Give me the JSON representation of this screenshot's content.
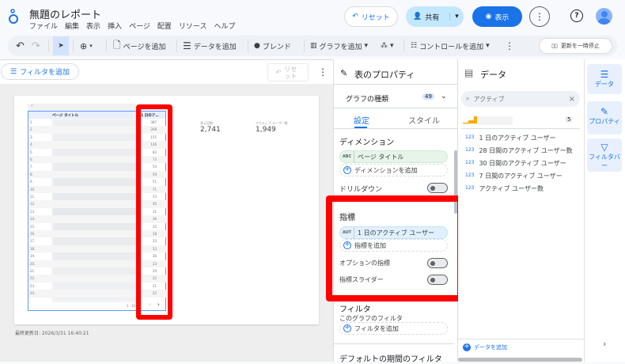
{
  "app": {
    "title": "無題のレポート",
    "menu": [
      "ファイル",
      "編集",
      "表示",
      "挿入",
      "ページ",
      "配置",
      "リソース",
      "ヘルプ"
    ],
    "reset": "リセット",
    "share": "共有",
    "view": "表示"
  },
  "toolbar": {
    "add_page": "ページを追加",
    "add_data": "データを追加",
    "blend": "ブレンド",
    "add_chart": "グラフを追加",
    "add_control": "コントロールを追加",
    "pause": "更新を一時停止"
  },
  "canvas": {
    "add_filter": "フィルタを追加",
    "reset": "リセット",
    "last_updated": "最終更新日: 2026/3/31 16:40:21",
    "table": {
      "col1": "ページ タイトル",
      "col2": "1 日のア…",
      "pagination": "1 - 100",
      "rows": [
        387,
        208,
        155,
        126,
        83,
        73,
        54,
        59,
        51,
        71,
        53,
        45,
        31,
        36,
        25,
        18,
        33,
        33,
        36,
        23,
        29,
        25,
        21,
        22
      ]
    },
    "scorecards": [
      {
        "label": "表示回数",
        "value": "2,741"
      },
      {
        "label": "アクティブ ユーザー数",
        "value": "1,949"
      }
    ]
  },
  "properties": {
    "title": "表のプロパティ",
    "chart_type": "グラフの種類",
    "chart_type_count": "49",
    "tabs": [
      "設定",
      "スタイル"
    ],
    "dimension_title": "ディメンション",
    "dimension_tag": "ABC",
    "dimension": "ページ タイトル",
    "add_dimension": "ディメンションを追加",
    "drilldown": "ドリルダウン",
    "metric_title": "指標",
    "metric_tag": "AUT",
    "metric": "1 日のアクティブ ユーザー",
    "add_metric": "指標を追加",
    "optional_metrics": "オプションの指標",
    "metric_slider": "指標スライダー",
    "filter_title": "フィルタ",
    "filter_sub": "このグラフのフィルタ",
    "add_filter": "フィルタを追加",
    "date_filter": "デフォルトの期間のフィルタ"
  },
  "data": {
    "title": "データ",
    "search": "アクティブ",
    "source_count": "5",
    "fields": [
      "1 日のアクティブ ユーザー",
      "28 日間のアクティブ ユーザー数",
      "30 日間のアクティブ ユーザー",
      "7 日間のアクティブ ユーザー",
      "アクティブ ユーザー数"
    ],
    "field_type": "123",
    "add_data": "データを追加"
  },
  "rail": {
    "data": "データ",
    "properties": "プロパティ",
    "filter_bar": "フィルタバー"
  },
  "colors": {
    "accent": "#1a73e8",
    "highlight": "#ff0000"
  }
}
